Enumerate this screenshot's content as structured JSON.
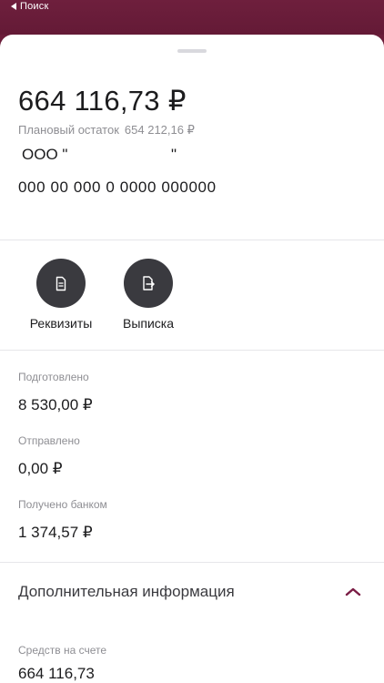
{
  "nav": {
    "back_label": "Поиск"
  },
  "account": {
    "balance": "664 116,73 ₽",
    "planned_label": "Плановый остаток",
    "planned_value": "654 212,16 ₽",
    "company_prefix": "ООО \"",
    "company_suffix": "\"",
    "number": "000  00 000 0 0000 000000"
  },
  "actions": [
    {
      "label": "Реквизиты",
      "icon": "document-icon"
    },
    {
      "label": "Выписка",
      "icon": "export-document-icon"
    }
  ],
  "stats": [
    {
      "label": "Подготовлено",
      "value": "8 530,00 ₽"
    },
    {
      "label": "Отправлено",
      "value": "0,00 ₽"
    },
    {
      "label": "Получено банком",
      "value": "1 374,57 ₽"
    }
  ],
  "additional": {
    "title": "Дополнительная информация",
    "expanded": true,
    "funds_label": "Средств на счете",
    "funds_value": "664 116,73"
  },
  "colors": {
    "brand": "#6b1d3a",
    "chevron": "#7a1d45",
    "action_circle": "#3a3a3f"
  }
}
